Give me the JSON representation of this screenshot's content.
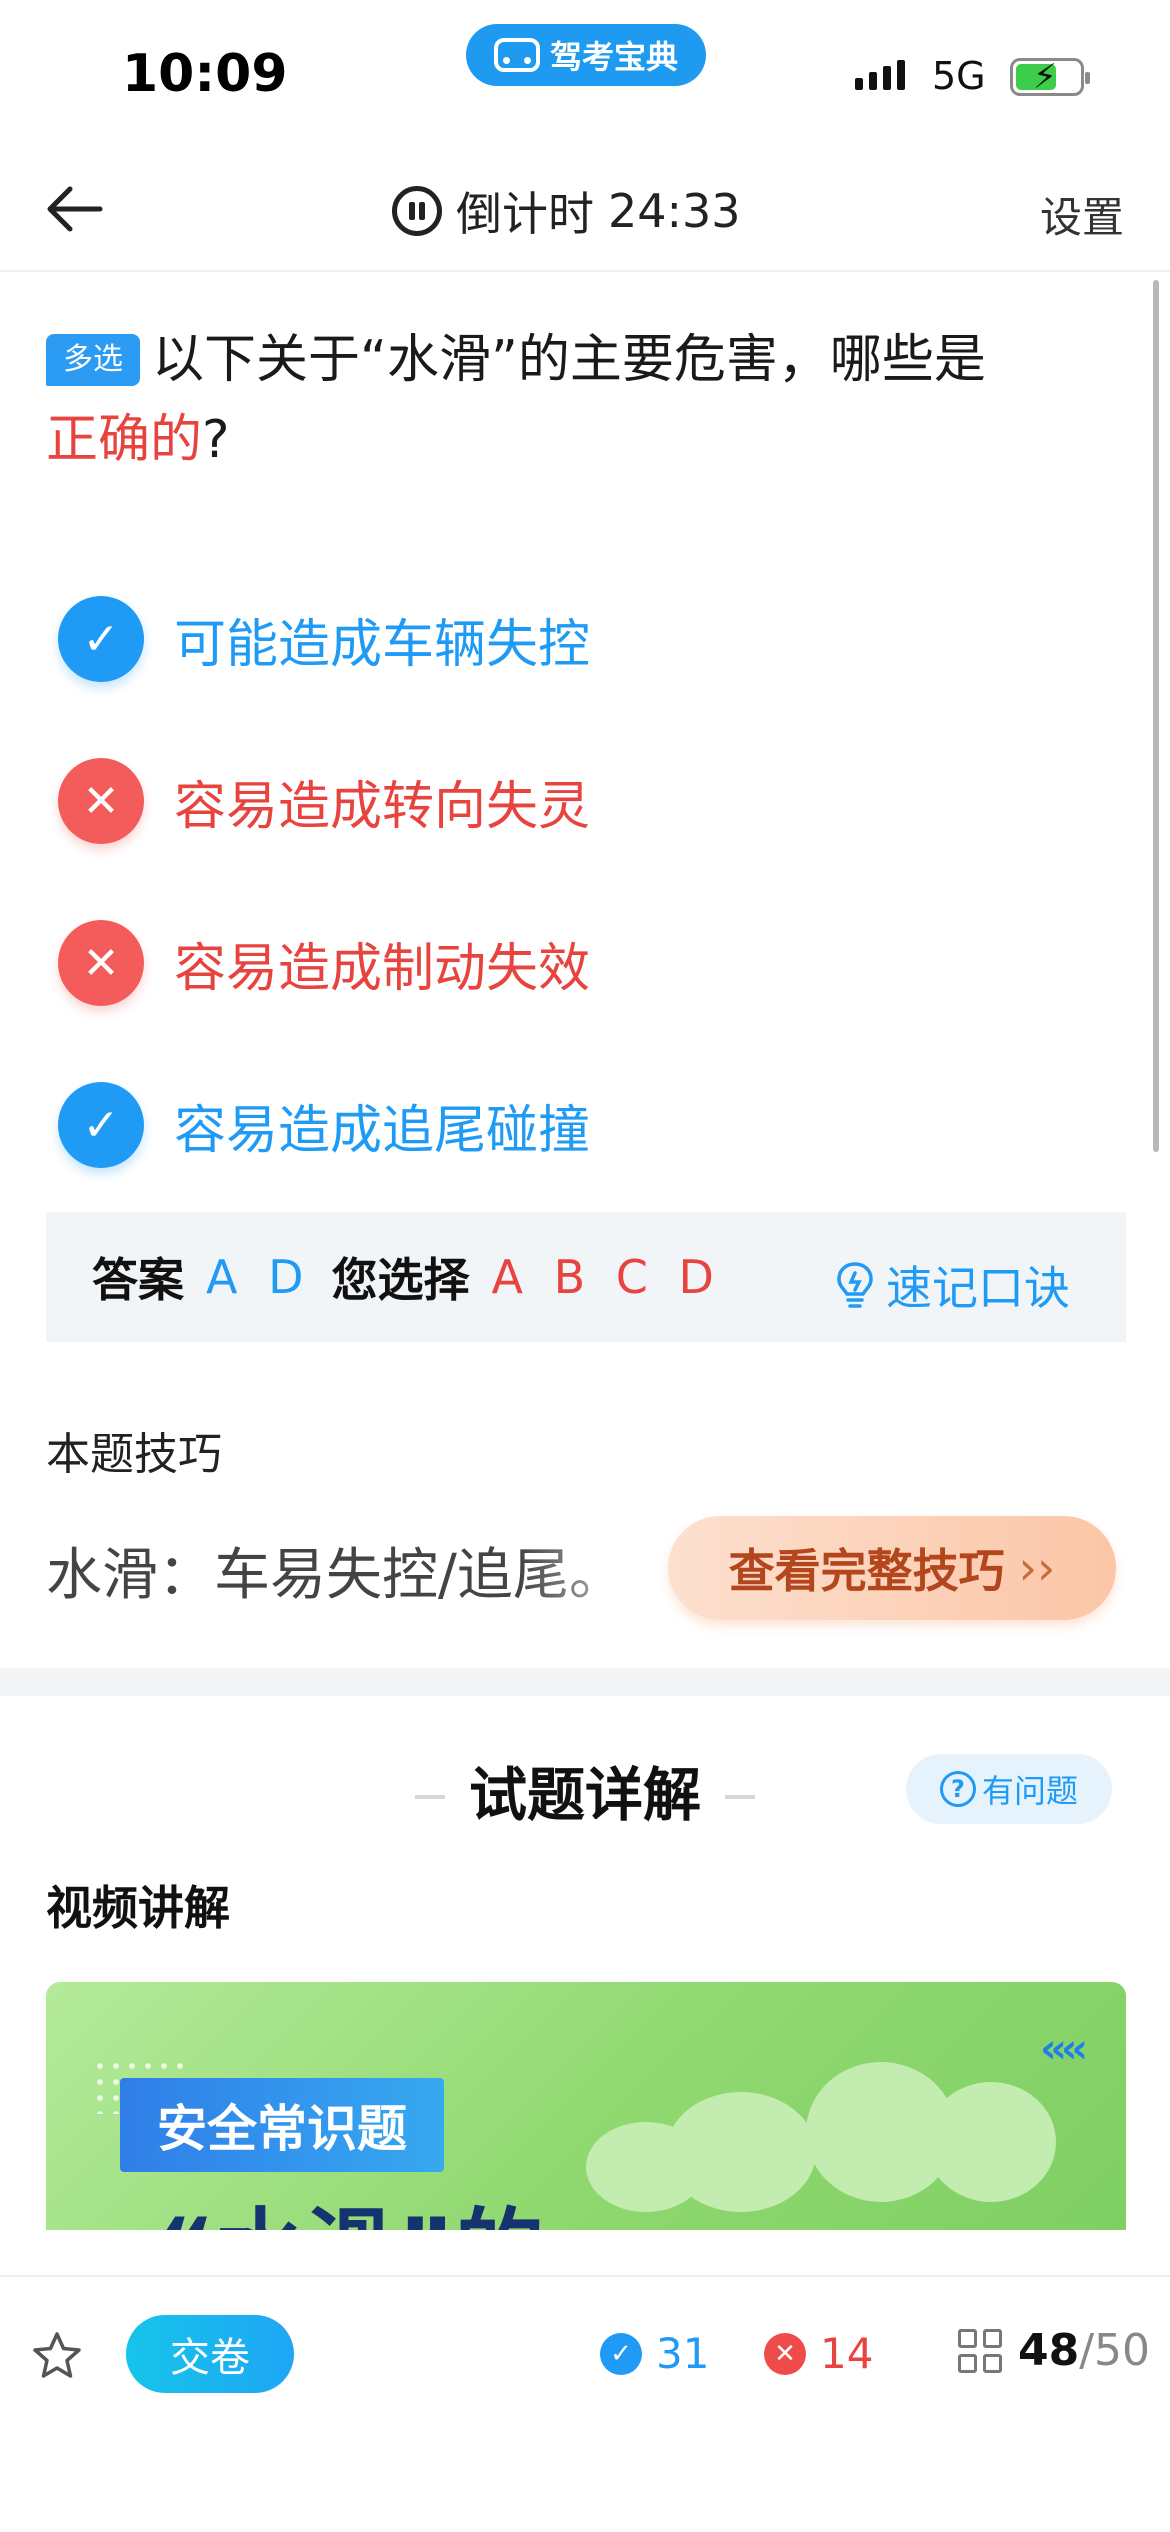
{
  "status_bar": {
    "time": "10:09",
    "app_name": "驾考宝典",
    "network": "5G"
  },
  "nav": {
    "timer_label": "倒计时",
    "timer_value": "24:33",
    "settings": "设置"
  },
  "question": {
    "type_tag": "多选",
    "text_main": "以下关于“水滑”的主要危害，哪些是",
    "text_highlight": "正确的",
    "text_end": "?",
    "options": [
      {
        "text": "可能造成车辆失控",
        "status": "correct"
      },
      {
        "text": "容易造成转向失灵",
        "status": "wrong"
      },
      {
        "text": "容易造成制动失效",
        "status": "wrong"
      },
      {
        "text": "容易造成追尾碰撞",
        "status": "correct"
      }
    ]
  },
  "answer": {
    "label": "答案",
    "correct": "A D",
    "selected_label": "您选择",
    "selected": "A B C D",
    "memo_button": "速记口诀"
  },
  "tips": {
    "title": "本题技巧",
    "text": "水滑：车易失控/追尾。",
    "button": "查看完整技巧"
  },
  "explanation": {
    "title": "试题详解",
    "ask_button": "有问题",
    "video_label": "视频讲解",
    "video_badge": "安全常识题",
    "video_headline": "“水滑”的"
  },
  "bottom_bar": {
    "submit": "交卷",
    "correct_count": "31",
    "wrong_count": "14",
    "progress_current": "48",
    "progress_total": "/50"
  },
  "colors": {
    "accent_blue": "#1f9bf5",
    "error_red": "#e8443f",
    "tips_orange": "#b3461c"
  }
}
